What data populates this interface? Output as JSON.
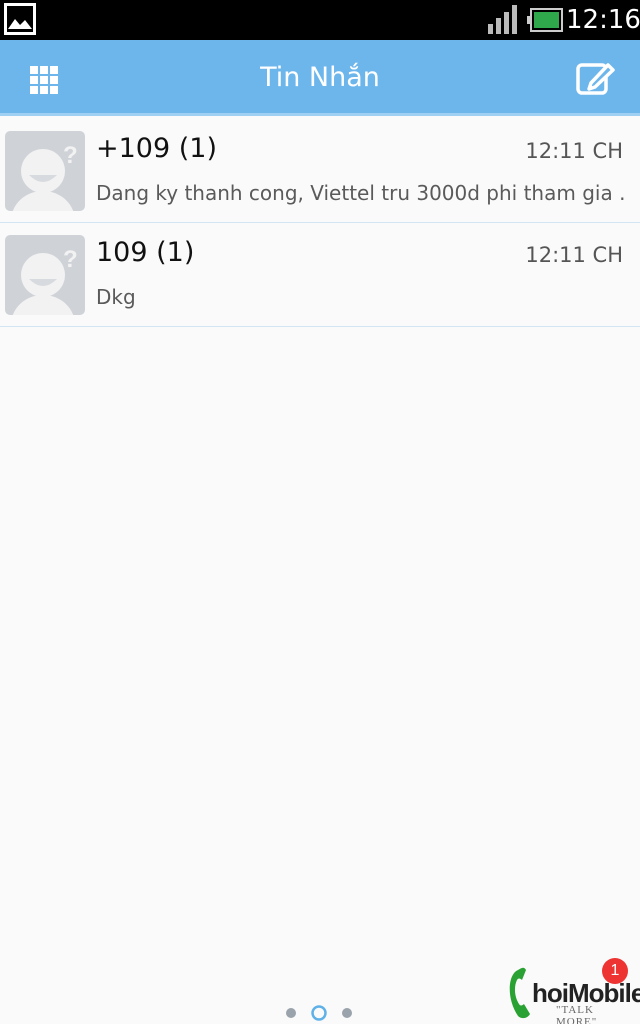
{
  "status_bar": {
    "time": "12:16",
    "icons": [
      "gallery-icon",
      "signal-icon",
      "battery-icon"
    ]
  },
  "header": {
    "title": "Tin Nhắn",
    "left_icon": "grid-menu-icon",
    "right_icon": "compose-icon",
    "background": "#6cb6ec"
  },
  "conversations": [
    {
      "name": "+109 (1)",
      "time": "12:11 CH",
      "preview": "Dang ky thanh cong, Viettel tru 3000d phi tham gia ..."
    },
    {
      "name": "109 (1)",
      "time": "12:11 CH",
      "preview": "Dkg"
    }
  ],
  "pager": {
    "count": 3,
    "active_index": 1
  },
  "watermark": {
    "brand": "hoiMobile",
    "tagline": "\"TALK MORE\"",
    "badge": "1"
  }
}
